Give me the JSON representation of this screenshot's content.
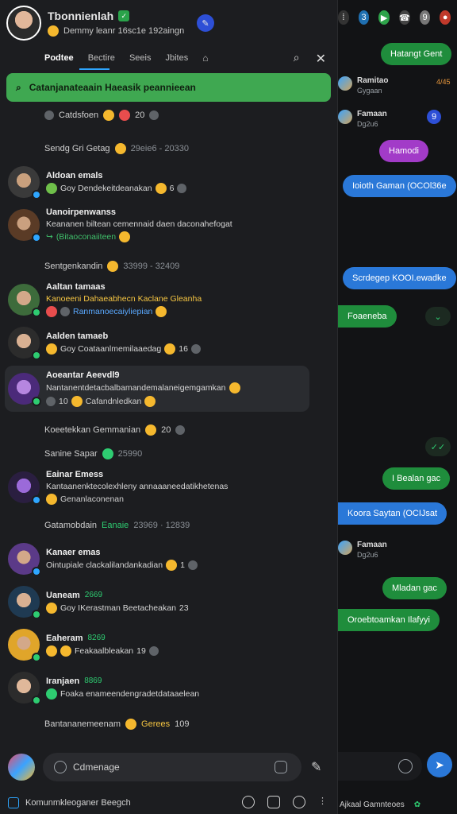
{
  "header": {
    "name": "Tbonnienlah",
    "status": "Demmy leanr 16sc1e 192aingn"
  },
  "tabs": {
    "items": [
      "Podtee",
      "Bectire",
      "Seeis",
      "Jbites"
    ],
    "active": 1
  },
  "banner": {
    "text": "Catanjanateaain Haeasik peannieean"
  },
  "sections": {
    "s0": {
      "title": "Catdsfoen",
      "count": "20"
    },
    "s1": {
      "title": "Sendg Gri Getag",
      "meta": "29eie6 - 20330"
    },
    "s2": {
      "title": "Sentgenkandin",
      "meta": "33999 - 32409"
    },
    "s3": {
      "title": "Koeetekkan Gemmanian",
      "count": "20"
    },
    "s4": {
      "title": "Sanine Sapar",
      "meta": "25990"
    },
    "s5": {
      "title": "Gatamobdain",
      "tag": "Eanaie",
      "meta": "23969 · 12839"
    },
    "s6": {
      "title": "Bantananemeenam",
      "tag": "Gerees",
      "count": "109"
    }
  },
  "items": [
    {
      "name": "Aldoan emals",
      "msg": "Goy Dendekeitdeanakan",
      "count": "6"
    },
    {
      "name": "Uanoirpenwanss",
      "msg": "Keananen biltean cemennaid daen daconahefogat",
      "msg2": "(Bitaoconaiiteen"
    },
    {
      "name": "Aaltan tamaas",
      "msg": "Kanoeeni Dahaeabhecn Kaclane Gleanha",
      "msg2": "Ranmanoecaiyliepian"
    },
    {
      "name": "Aalden tamaeb",
      "msg": "Goy Coataanlmemilaaedag",
      "count": "16"
    },
    {
      "name": "Aoeantar Aeevdl9",
      "msg": "Nantanentdetacbalbamandemalaneigemgamkan",
      "msg2": "Cafandnledkan",
      "count2": "10"
    },
    {
      "name": "Eainar Emess",
      "msg": "Kantaanenktecolexhleny annaaaneedatikhetenas",
      "msg2": "Genanlaconenan"
    },
    {
      "name": "Kanaer emas",
      "msg": "Ointupiale clackalilandankadian",
      "count": "1"
    },
    {
      "name": "Uaneam",
      "tag": "2669",
      "msg": "Goy IKerastman Beetacheakan",
      "count": "23"
    },
    {
      "name": "Eaheram",
      "tag": "8269",
      "msg": "Feakaalbleakan",
      "count": "19"
    },
    {
      "name": "Iranjaen",
      "tag": "8869",
      "msg": "Foaka enameendengradetdataaelean"
    }
  ],
  "composer": {
    "placeholder": "Cdmenage"
  },
  "footer": {
    "text": "Komunmkleoganer Beegch"
  },
  "chat": {
    "bubbles": [
      "Hatangt Gent",
      "Hamodi",
      "Ioioth Gaman (OCOl36e",
      "Scrdegep KOOI.ewadke",
      "Foaeneba",
      "I Bealan gac",
      "Koora Saytan (OCIJsat",
      "Mladan gac",
      "Oroebtoamkan Ilafyyi"
    ],
    "contacts": [
      {
        "name": "Ramitao",
        "sub": "Gygaan"
      },
      {
        "name": "Famaan",
        "sub": "Dg2u6"
      },
      {
        "name": "Famaan",
        "sub": "Dg2u6"
      }
    ],
    "badges": [
      "4/45",
      "9"
    ],
    "footer": "Ajkaal Gamnteoes"
  },
  "colors": {
    "bg": "#0f1012",
    "panel": "#1c1d20",
    "accent_green": "#3fa851",
    "accent_blue": "#2a78d8",
    "accent_purple": "#a23bc8"
  }
}
